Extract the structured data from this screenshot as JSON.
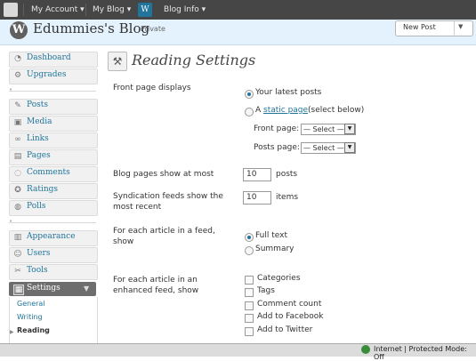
{
  "adminbar": {
    "my_account": "My Account ▾",
    "my_blog": "My Blog ▾",
    "blog_info": "Blog Info ▾"
  },
  "header": {
    "blog_title": "Edummies's Blog",
    "private_label": "Private",
    "new_post": "New Post"
  },
  "sidebar": {
    "items": [
      {
        "label": "Dashboard",
        "icon": "gauge-icon"
      },
      {
        "label": "Upgrades",
        "icon": "gear-icon"
      },
      {
        "label": "Posts",
        "icon": "pin-icon"
      },
      {
        "label": "Media",
        "icon": "media-icon"
      },
      {
        "label": "Links",
        "icon": "link-icon"
      },
      {
        "label": "Pages",
        "icon": "page-icon"
      },
      {
        "label": "Comments",
        "icon": "comment-icon"
      },
      {
        "label": "Ratings",
        "icon": "star-icon"
      },
      {
        "label": "Polls",
        "icon": "poll-icon"
      },
      {
        "label": "Appearance",
        "icon": "appearance-icon"
      },
      {
        "label": "Users",
        "icon": "users-icon"
      },
      {
        "label": "Tools",
        "icon": "tools-icon"
      }
    ],
    "settings_label": "Settings",
    "settings_sub": [
      "General",
      "Writing",
      "Reading"
    ]
  },
  "main": {
    "page_title": "Reading Settings",
    "front_page_label": "Front page displays",
    "opt_latest": "Your latest posts",
    "opt_static_prefix": "A",
    "opt_static_link": "static page",
    "opt_static_suffix": "(select below)",
    "front_page_label2": "Front page:",
    "posts_page_label": "Posts page:",
    "select_text": "— Select —",
    "blog_pages_label": "Blog pages show at most",
    "blog_pages_value": "10",
    "blog_pages_unit": "posts",
    "syndication_label_1": "Syndication feeds show the",
    "syndication_label_2": "most recent",
    "syndication_value": "10",
    "syndication_unit": "items",
    "feed_label_1": "For each article in a feed,",
    "feed_label_2": "show",
    "opt_full_text": "Full text",
    "opt_summary": "Summary",
    "enhanced_label_1": "For each article in an",
    "enhanced_label_2": "enhanced feed, show",
    "checkboxes": [
      "Categories",
      "Tags",
      "Comment count",
      "Add to Facebook",
      "Add to Twitter"
    ]
  },
  "statusbar": {
    "text": "Internet | Protected Mode: Off"
  }
}
